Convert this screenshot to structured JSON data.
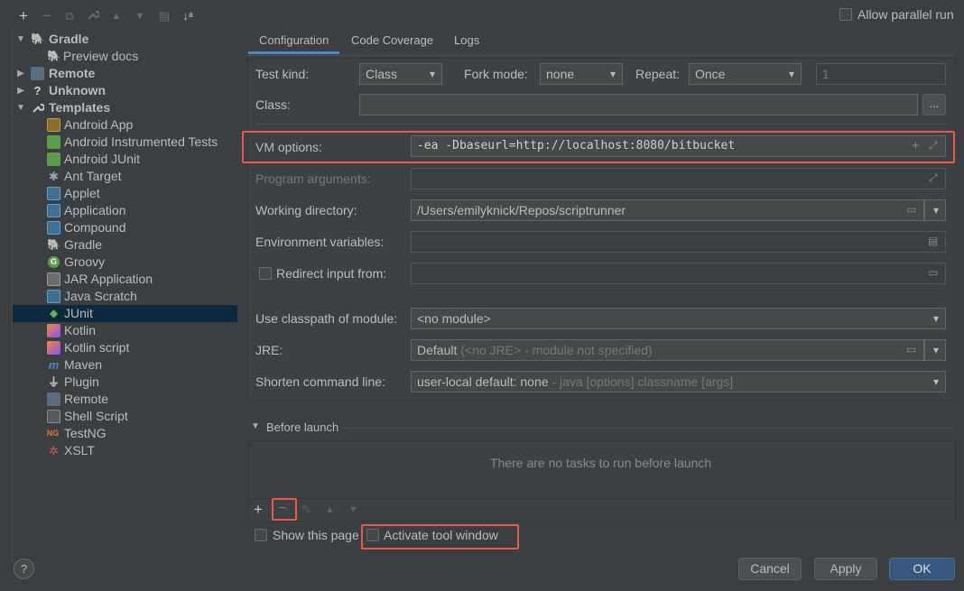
{
  "toolbar": {
    "add": "+",
    "remove": "−",
    "copy": "⧉",
    "wrench": "🔧",
    "up": "▲",
    "down": "▼",
    "folder": "▤",
    "sort": "↓ᵃ"
  },
  "allow_parallel_run": "Allow parallel run",
  "tree": {
    "gradle": "Gradle",
    "preview_docs": "Preview docs",
    "remote": "Remote",
    "unknown": "Unknown",
    "templates": "Templates",
    "items": [
      "Android App",
      "Android Instrumented Tests",
      "Android JUnit",
      "Ant Target",
      "Applet",
      "Application",
      "Compound",
      "Gradle",
      "Groovy",
      "JAR Application",
      "Java Scratch",
      "JUnit",
      "Kotlin",
      "Kotlin script",
      "Maven",
      "Plugin",
      "Remote",
      "Shell Script",
      "TestNG",
      "XSLT"
    ]
  },
  "tabs": [
    "Configuration",
    "Code Coverage",
    "Logs"
  ],
  "form": {
    "test_kind_label": "Test kind:",
    "test_kind_value": "Class",
    "fork_mode_label": "Fork mode:",
    "fork_mode_value": "none",
    "repeat_label": "Repeat:",
    "repeat_value": "Once",
    "repeat_count": "1",
    "class_label": "Class:",
    "class_browse": "...",
    "vm_options_label": "VM options:",
    "vm_options_value": "-ea -Dbaseurl=http://localhost:8080/bitbucket",
    "program_args_label": "Program arguments:",
    "working_dir_label": "Working directory:",
    "working_dir_value": "/Users/emilyknick/Repos/scriptrunner",
    "env_vars_label": "Environment variables:",
    "redirect_label": "Redirect input from:",
    "classpath_label": "Use classpath of module:",
    "classpath_value": "<no module>",
    "jre_label": "JRE:",
    "jre_value": "Default",
    "jre_hint": "(<no JRE> - module not specified)",
    "shorten_label": "Shorten command line:",
    "shorten_value": "user-local default: none",
    "shorten_hint": "- java [options] classname [args]"
  },
  "before_launch": {
    "title": "Before launch",
    "empty": "There are no tasks to run before launch"
  },
  "show_this_page": "Show this page",
  "activate_tool_window": "Activate tool window",
  "buttons": {
    "help": "?",
    "cancel": "Cancel",
    "apply": "Apply",
    "ok": "OK"
  }
}
